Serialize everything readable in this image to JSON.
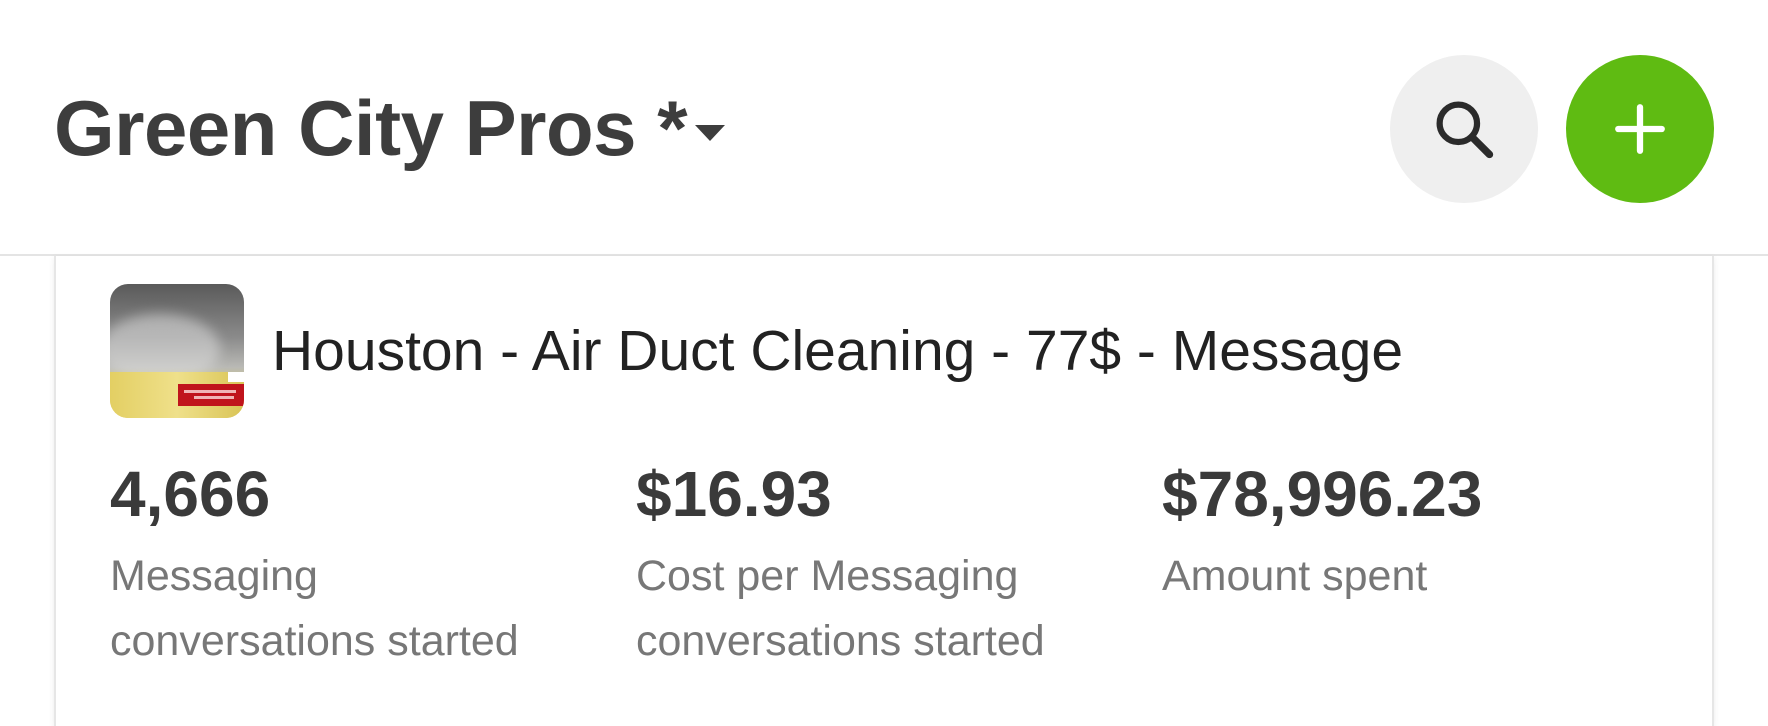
{
  "header": {
    "account_name": "Green City Pros *",
    "account_dropdown_icon": "caret-down-icon",
    "search_icon": "search-icon",
    "add_icon": "plus-icon",
    "add_button_color": "#5fbb12"
  },
  "ad": {
    "name": "Houston - Air Duct Cleaning - 77$ - Message",
    "thumbnail": "ad-thumbnail-image",
    "metrics": [
      {
        "value": "4,666",
        "label_line1": "Messaging",
        "label_line2": "conversations started"
      },
      {
        "value": "$16.93",
        "label_line1": "Cost per Messaging",
        "label_line2": "conversations started"
      },
      {
        "value": "$78,996.23",
        "label_line1": "Amount spent",
        "label_line2": ""
      }
    ]
  }
}
